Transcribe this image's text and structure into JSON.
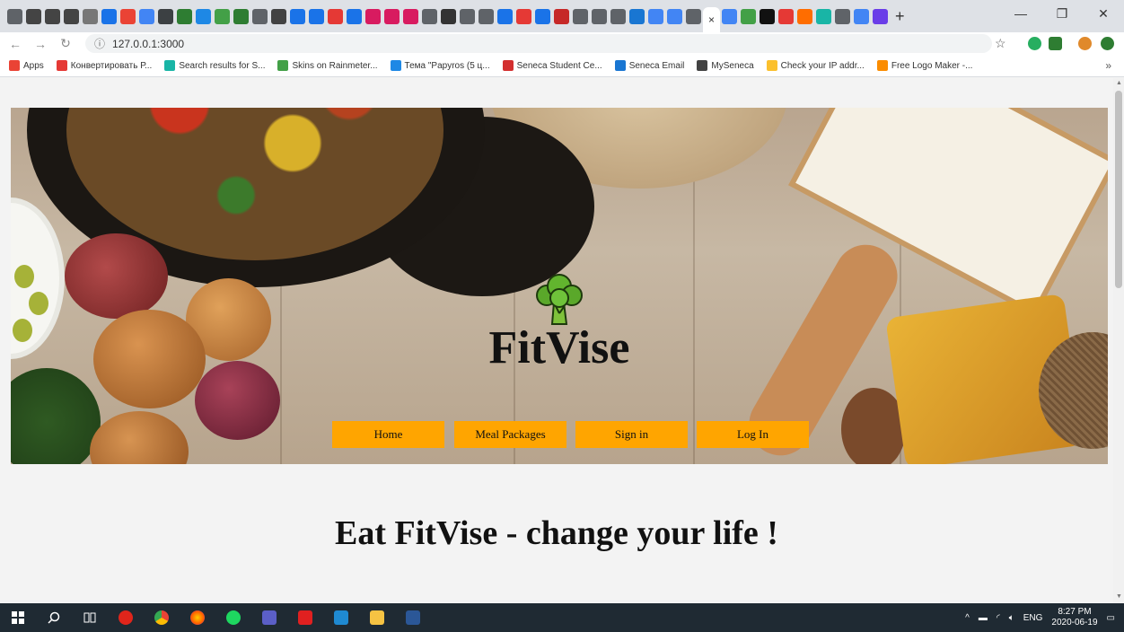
{
  "browser": {
    "url": "127.0.0.1:3000",
    "tab_count_icons": 44,
    "new_tab_label": "+",
    "close_tab_label": "×",
    "window_controls": [
      "—",
      "❐",
      "✕"
    ]
  },
  "bookmarks": [
    {
      "label": "Apps",
      "color": "#ea4335"
    },
    {
      "label": "Конвертировать Р...",
      "color": "#e53935"
    },
    {
      "label": "Search results for S...",
      "color": "#19b5a6"
    },
    {
      "label": "Skins on Rainmeter...",
      "color": "#43a047"
    },
    {
      "label": "Тема \"Papyros (5 ц...",
      "color": "#1e88e5"
    },
    {
      "label": "Seneca Student Ce...",
      "color": "#d32f2f"
    },
    {
      "label": "Seneca Email",
      "color": "#1976d2"
    },
    {
      "label": "MySeneca",
      "color": "#424242"
    },
    {
      "label": "Check your IP addr...",
      "color": "#fbc02d"
    },
    {
      "label": "Free Logo Maker -...",
      "color": "#fb8c00"
    }
  ],
  "bookmarks_more": "»",
  "site": {
    "brand": "FitVise",
    "nav": [
      {
        "label": "Home"
      },
      {
        "label": "Meal Packages"
      },
      {
        "label": "Sign in"
      },
      {
        "label": "Log In"
      }
    ],
    "tagline": "Eat FitVise - change your life !",
    "accent_color": "#ffa500"
  },
  "taskbar": {
    "tray_lang": "ENG",
    "time": "8:27 PM",
    "date": "2020-06-19"
  }
}
